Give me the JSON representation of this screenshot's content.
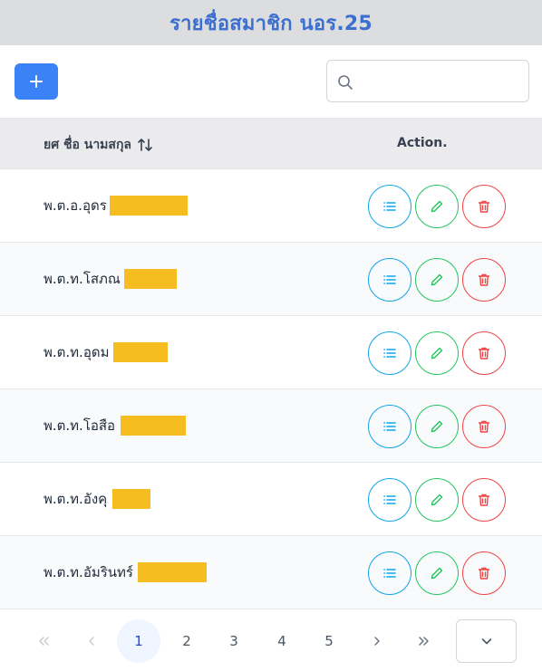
{
  "header": {
    "title": "รายชื่อสมาชิก นอร.25"
  },
  "toolbar": {
    "add_label": "+",
    "search": {
      "value": "",
      "placeholder": ""
    }
  },
  "table": {
    "columns": {
      "name": "ยศ ชื่อ นามสกุล",
      "action": "Action."
    },
    "rows": [
      {
        "name": "พ.ต.อ.อุดร"
      },
      {
        "name": "พ.ต.ท.โสภณ"
      },
      {
        "name": "พ.ต.ท.อุดม"
      },
      {
        "name": "พ.ต.ท.โอสือ"
      },
      {
        "name": "พ.ต.ท.อังคุ"
      },
      {
        "name": "พ.ต.ท.อัมรินทร์"
      }
    ]
  },
  "pagination": {
    "first": "«",
    "prev": "‹",
    "pages": [
      "1",
      "2",
      "3",
      "4",
      "5"
    ],
    "current": "1",
    "next": "›",
    "last": "»"
  },
  "colors": {
    "title": "#3d6fd0",
    "primary": "#3b82f6",
    "view": "#0ea5e9",
    "edit": "#22c55e",
    "delete": "#ef4444",
    "redaction": "#f5bd1f"
  },
  "icons": {
    "add": "plus-icon",
    "search": "search-icon",
    "sort": "sort-icon",
    "view": "list-icon",
    "edit": "pencil-icon",
    "delete": "trash-icon",
    "dropdown": "chevron-down-icon"
  }
}
